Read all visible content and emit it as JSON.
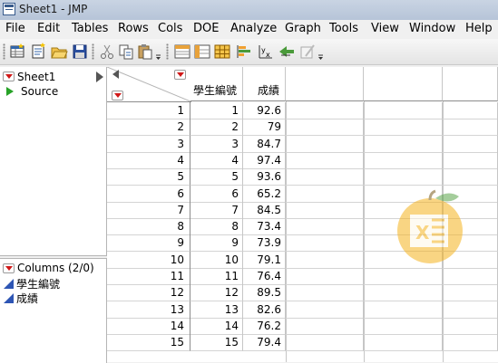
{
  "window": {
    "title": "Sheet1 - JMP"
  },
  "menu": [
    "File",
    "Edit",
    "Tables",
    "Rows",
    "Cols",
    "DOE",
    "Analyze",
    "Graph",
    "Tools",
    "View",
    "Window",
    "Help"
  ],
  "toolbar": {
    "icons": [
      "new-data-table-icon",
      "new-script-icon",
      "open-icon",
      "save-icon",
      "cut-icon",
      "copy-icon",
      "paste-icon",
      "data-table-list-icon",
      "table-panel-icon",
      "grid-icon",
      "distribution-icon",
      "fit-y-by-x-icon",
      "fit-model-icon",
      "annotate-icon"
    ]
  },
  "tables_panel": {
    "table_name": "Sheet1",
    "source_label": "Source"
  },
  "columns_panel": {
    "header": "Columns (2/0)",
    "columns": [
      "學生編號",
      "成績"
    ]
  },
  "table": {
    "headers": [
      "學生編號",
      "成績"
    ],
    "rows": [
      [
        "1",
        "1",
        "92.6"
      ],
      [
        "2",
        "2",
        "79"
      ],
      [
        "3",
        "3",
        "84.7"
      ],
      [
        "4",
        "4",
        "97.4"
      ],
      [
        "5",
        "5",
        "93.6"
      ],
      [
        "6",
        "6",
        "65.2"
      ],
      [
        "7",
        "7",
        "84.5"
      ],
      [
        "8",
        "8",
        "73.4"
      ],
      [
        "9",
        "9",
        "73.9"
      ],
      [
        "10",
        "10",
        "79.1"
      ],
      [
        "11",
        "11",
        "76.4"
      ],
      [
        "12",
        "12",
        "89.5"
      ],
      [
        "13",
        "13",
        "82.6"
      ],
      [
        "14",
        "14",
        "76.2"
      ],
      [
        "15",
        "15",
        "79.4"
      ]
    ]
  },
  "colors": {
    "accent_red": "#d01818",
    "source_green": "#27a227",
    "column_blue": "#2d55b4"
  }
}
